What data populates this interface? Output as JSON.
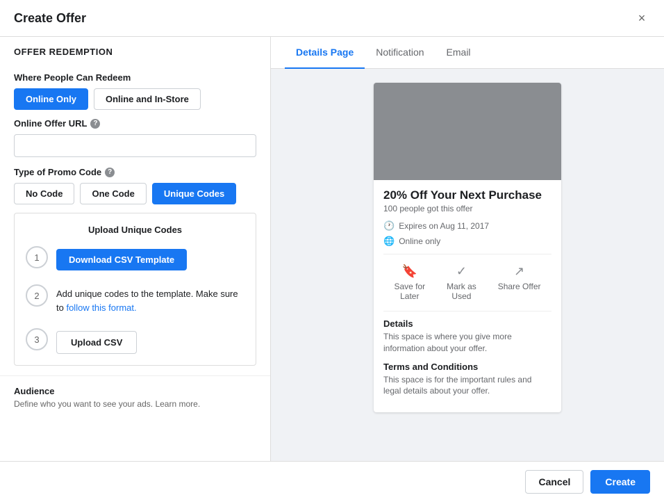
{
  "modal": {
    "title": "Create Offer",
    "close_icon": "×"
  },
  "left_panel": {
    "section_heading": "Offer Redemption",
    "where_people_redeem_label": "Where People Can Redeem",
    "online_only_label": "Online Only",
    "online_and_in_store_label": "Online and In-Store",
    "online_offer_url_label": "Online Offer URL",
    "online_offer_url_placeholder": "",
    "type_of_promo_code_label": "Type of Promo Code",
    "no_code_label": "No Code",
    "one_code_label": "One Code",
    "unique_codes_label": "Unique Codes",
    "upload_box_title": "Upload Unique Codes",
    "step1_number": "1",
    "download_csv_label": "Download CSV Template",
    "step2_number": "2",
    "step2_text_before_link": "Add unique codes to the template. Make sure to ",
    "step2_link_text": "follow this format.",
    "step3_number": "3",
    "upload_csv_label": "Upload CSV",
    "audience_label": "Audience",
    "audience_sub": "Define who you want to see your ads. Learn more."
  },
  "right_panel": {
    "tabs": [
      {
        "label": "Details Page",
        "active": true
      },
      {
        "label": "Notification",
        "active": false
      },
      {
        "label": "Email",
        "active": false
      }
    ],
    "offer_card": {
      "title": "20% Off Your Next Purchase",
      "claimed": "100 people got this offer",
      "expires_label": "Expires on Aug 11, 2017",
      "location_label": "Online only",
      "save_for_later_label": "Save for\nLater",
      "mark_as_used_label": "Mark as\nUsed",
      "share_offer_label": "Share\nOffer",
      "details_title": "Details",
      "details_text": "This space is where you give more information about your offer.",
      "terms_title": "Terms and Conditions",
      "terms_text": "This space is for the important rules and legal details about your offer."
    }
  },
  "footer": {
    "cancel_label": "Cancel",
    "create_label": "Create"
  }
}
